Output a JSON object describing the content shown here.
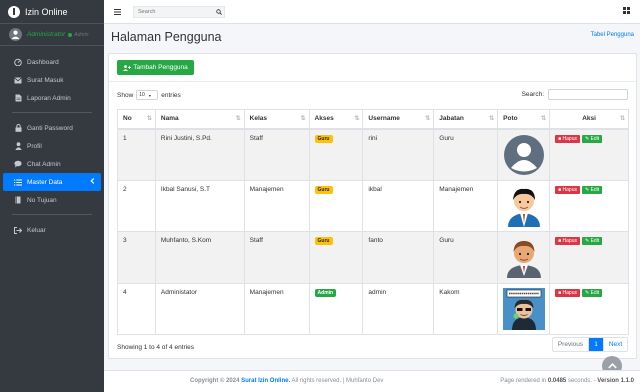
{
  "app": {
    "title": "Izin Online"
  },
  "user": {
    "name": "Administrator",
    "status": "Admin"
  },
  "sidebar": {
    "items": [
      {
        "label": "Dashboard",
        "icon": "dashboard-icon"
      },
      {
        "label": "Surat Masuk",
        "icon": "envelope-icon"
      },
      {
        "label": "Laporan Admin",
        "icon": "file-icon"
      },
      {
        "label": "Ganti Password",
        "icon": "lock-icon"
      },
      {
        "label": "Profil",
        "icon": "user-icon"
      },
      {
        "label": "Chat Admin",
        "icon": "chat-icon"
      },
      {
        "label": "Master Data",
        "icon": "list-icon",
        "active": true
      },
      {
        "label": "No Tujuan",
        "icon": "book-icon"
      },
      {
        "label": "Keluar",
        "icon": "sign-out-icon"
      }
    ]
  },
  "topbar": {
    "search_placeholder": "Search"
  },
  "page": {
    "title": "Halaman Pengguna",
    "breadcrumb": "Tabel Pengguna"
  },
  "card": {
    "add_button": "Tambah Pengguna",
    "show_label": "Show",
    "entries_value": "10",
    "entries_label": "entries",
    "search_label": "Search:",
    "columns": [
      "No",
      "Nama",
      "Kelas",
      "Akses",
      "Username",
      "Jabatan",
      "Poto",
      "Aksi"
    ],
    "rows": [
      {
        "no": "1",
        "nama": "Rini Justini, S.Pd.",
        "kelas": "Staff",
        "akses": "Guru",
        "username": "rini",
        "jabatan": "Guru",
        "photo": "default-avatar"
      },
      {
        "no": "2",
        "nama": "Ikbal Sanusi, S.T",
        "kelas": "Manajemen",
        "akses": "Guru",
        "username": "ikbal",
        "jabatan": "Manajemen",
        "photo": "man-avatar"
      },
      {
        "no": "3",
        "nama": "Muhfanto, S.Kom",
        "kelas": "Staff",
        "akses": "Guru",
        "username": "fanto",
        "jabatan": "Guru",
        "photo": "man-suit-avatar"
      },
      {
        "no": "4",
        "nama": "Administator",
        "kelas": "Manajemen",
        "akses": "Admin",
        "username": "admin",
        "jabatan": "Kakom",
        "photo": "admin-avatar"
      }
    ],
    "hapus_label": "Hapus",
    "edit_label": "Edit",
    "info": "Showing 1 to 4 of 4 entries",
    "pager": {
      "prev": "Previous",
      "current": "1",
      "next": "Next"
    }
  },
  "footer": {
    "copyright_prefix": "Copyright © 2024",
    "brand": "Surat Izin Online.",
    "rest": "All rights reserved. | Muhfanto Dev",
    "render_prefix": "Page rendered in",
    "render_time": "0.0485",
    "render_suffix": "seconds. -",
    "version": "Version 1.1.0"
  },
  "colors": {
    "sidebar_bg": "#343a40",
    "primary": "#007bff",
    "success": "#28a745",
    "danger": "#dc3545",
    "warning": "#ffc107"
  }
}
